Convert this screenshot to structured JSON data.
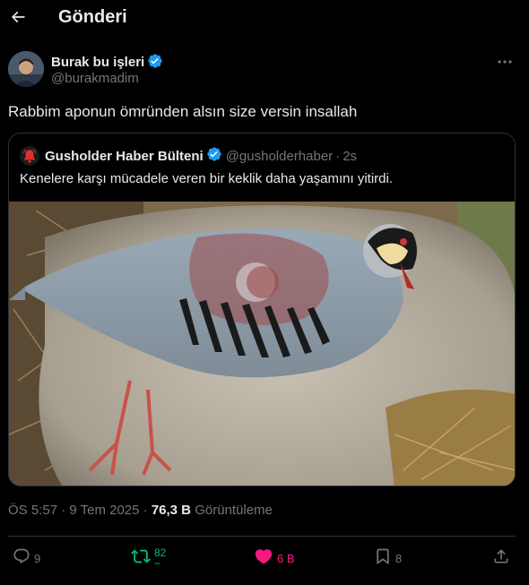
{
  "header": {
    "title": "Gönderi"
  },
  "tweet": {
    "author_name": "Burak bu işleri",
    "author_handle": "@burakmadim",
    "text": "Rabbim aponun ömründen alsın size versin insallah",
    "timestamp": "ÖS 5:57 · 9 Tem 2025 · ",
    "views_count": "76,3 B",
    "views_label": "Görüntüleme"
  },
  "quote": {
    "author_name": "Gusholder Haber Bülteni",
    "author_handle": "@gusholderhaber",
    "separator": "·",
    "time": "2s",
    "text": "Kenelere karşı mücadele veren bir keklik daha yaşamını yitirdi."
  },
  "actions": {
    "replies": "9",
    "retweets": "82",
    "retweets_dash": "--",
    "likes": "6 B",
    "bookmarks": "8"
  },
  "colors": {
    "background": "#000000",
    "text_primary": "#e7e9ea",
    "text_secondary": "#71767b",
    "border": "#2f3336",
    "verified": "#1d9bf0",
    "retweet_active": "#00ba7c",
    "like_active": "#f91880"
  },
  "icons": [
    "back-arrow-icon",
    "verified-badge-icon",
    "more-icon",
    "reply-icon",
    "retweet-icon",
    "heart-icon",
    "bookmark-icon",
    "share-icon",
    "bell-icon"
  ]
}
